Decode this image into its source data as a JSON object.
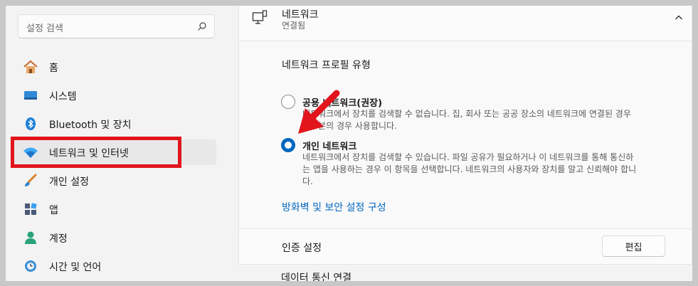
{
  "sidebar": {
    "search_placeholder": "설정 검색",
    "items": [
      {
        "label": "홈",
        "icon": "home-icon"
      },
      {
        "label": "시스템",
        "icon": "system-icon"
      },
      {
        "label": "Bluetooth 및 장치",
        "icon": "bluetooth-icon"
      },
      {
        "label": "네트워크 및 인터넷",
        "icon": "wifi-icon",
        "selected": true
      },
      {
        "label": "개인 설정",
        "icon": "brush-icon"
      },
      {
        "label": "앱",
        "icon": "apps-icon"
      },
      {
        "label": "계정",
        "icon": "account-icon"
      },
      {
        "label": "시간 및 언어",
        "icon": "clock-globe-icon"
      }
    ]
  },
  "network": {
    "title": "네트워크",
    "status": "연결됨",
    "profile_type_label": "네트워크 프로필 유형",
    "options": [
      {
        "title": "공용 네트워크(권장)",
        "desc_line1": "네트워크에서 장치를 검색할 수 없습니다. 집, 회사 또는 공공 장소의 네트워크에 연결된 경우",
        "desc_line2": "대부분의 경우 사용합니다.",
        "checked": false
      },
      {
        "title": "개인 네트워크",
        "desc_line1": "네트워크에서 장치를 검색할 수 있습니다. 파일 공유가 필요하거나 이 네트워크를 통해 통신하",
        "desc_line2": "는 앱을 사용하는 경우 이 항목을 선택합니다. 네트워크의 사용자와 장치를 알고 신뢰해야 합니",
        "desc_line3": "다.",
        "checked": true
      }
    ],
    "firewall_link": "방화벽 및 보안 설정 구성",
    "auth_label": "인증 설정",
    "edit_button": "편집",
    "cut_row_label": "데이터 통신 연결"
  },
  "colors": {
    "accent": "#0067c0",
    "annotation_red": "#e2141c"
  }
}
